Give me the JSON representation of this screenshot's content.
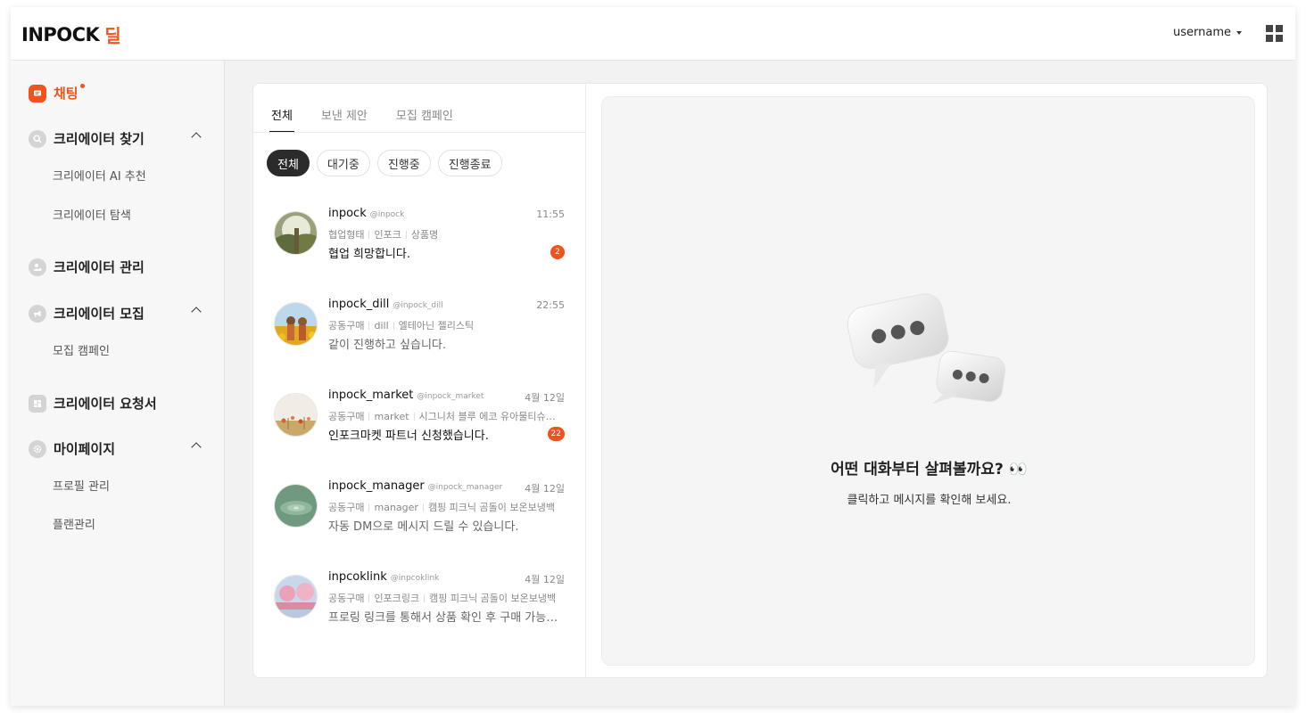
{
  "colors": {
    "accent": "#f0531d",
    "chip_active_bg": "#2b2b2b",
    "detail_bg": "#f5f5f5"
  },
  "header": {
    "logo_main": "INPOCK",
    "logo_sub": "딜",
    "username": "username",
    "apps_icon": "grid-icon"
  },
  "sidebar": {
    "chat": {
      "label": "채팅",
      "icon": "chat-icon",
      "has_dot": true
    },
    "find_creator": {
      "label": "크리에이터 찾기",
      "icon": "search-icon",
      "items": [
        "크리에이터 AI 추천",
        "크리에이터 탐색"
      ]
    },
    "manage_creator": {
      "label": "크리에이터 관리",
      "icon": "users-icon"
    },
    "recruit_creator": {
      "label": "크리에이터 모집",
      "icon": "megaphone-icon",
      "items": [
        "모집 캠페인"
      ]
    },
    "request_form": {
      "label": "크리에이터 요청서",
      "icon": "dashboard-icon"
    },
    "mypage": {
      "label": "마이페이지",
      "icon": "gear-icon",
      "items": [
        "프로필 관리",
        "플랜관리"
      ]
    }
  },
  "list": {
    "tabs": [
      "전체",
      "보낸 제안",
      "모집 캠페인"
    ],
    "active_tab": 0,
    "chips": [
      "전체",
      "대기중",
      "진행중",
      "진행종료"
    ],
    "active_chip": 0,
    "conversations": [
      {
        "name": "inpock",
        "handle": "@inpock",
        "time": "11:55",
        "tags": [
          "협업형태",
          "인포크",
          "상품명"
        ],
        "message": "협업 희망합니다.",
        "badge": "2",
        "unread": true
      },
      {
        "name": "inpock_dill",
        "handle": "@inpock_dill",
        "time": "22:55",
        "tags": [
          "공동구매",
          "dill",
          "엘테아닌 젤리스틱"
        ],
        "message": "같이 진행하고 싶습니다.",
        "badge": "",
        "unread": false
      },
      {
        "name": "inpock_market",
        "handle": "@inpock_market",
        "time": "4월 12일",
        "tags": [
          "공동구매",
          "market",
          "시그니처 블루 에코 유아물티슈…"
        ],
        "message": "인포크마켓 파트너 신청했습니다.",
        "badge": "22",
        "unread": true
      },
      {
        "name": "inpock_manager",
        "handle": "@inpock_manager",
        "time": "4월 12일",
        "tags": [
          "공동구매",
          "manager",
          "캠핑 피크닉 곰돌이 보온보냉백"
        ],
        "message": "자동 DM으로 메시지 드릴 수 있습니다.",
        "badge": "",
        "unread": false
      },
      {
        "name": "inpcoklink",
        "handle": "@inpcoklink",
        "time": "4월 12일",
        "tags": [
          "공동구매",
          "인포크링크",
          "캠핑 피크닉 곰돌이 보온보냉백"
        ],
        "message": "프로링 링크를 통해서 상품 확인 후 구매 가능…",
        "badge": "",
        "unread": false
      }
    ]
  },
  "detail": {
    "illustration": "speech-bubbles-illustration",
    "title": "어떤 대화부터 살펴볼까요? 👀",
    "subtitle": "클릭하고 메시지를 확인해 보세요."
  }
}
